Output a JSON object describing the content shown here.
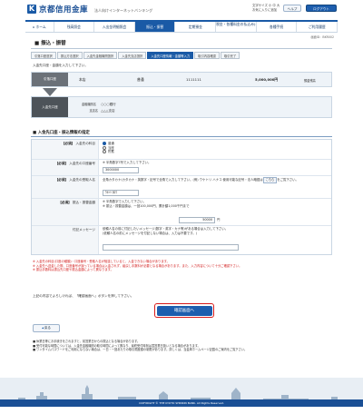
{
  "header": {
    "logo_mark": "K",
    "logo_text": "京都信用金庫",
    "logo_sub": "法人向けインターネットバンキング",
    "links": "文字サイズ 小 中 大\nお気に入りに追加",
    "help_label": "ヘルプ",
    "logout_label": "ログアウト"
  },
  "nav": {
    "items": [
      {
        "label": "ホーム"
      },
      {
        "label": "残高照会"
      },
      {
        "label": "入出金明細照会"
      },
      {
        "label": "振込・振替"
      },
      {
        "label": "定期預金"
      },
      {
        "label": "税金・各種料金の払込み(ペイジー)"
      },
      {
        "label": "各種手続"
      },
      {
        "label": "ご利用履歴"
      }
    ]
  },
  "screen_id": "画面ID：BKR002",
  "page_title": "振込・振替",
  "steps": [
    "引落口座選択",
    "振込方法選択",
    "入金先金融機関選択",
    "入金先支店選択",
    "入金先口座情報・金額等入力",
    "取引内容確認",
    "取引完了"
  ],
  "instruction": "入金先口座・金額を入力して下さい。",
  "from": {
    "head": "引落口座",
    "branch": "本店",
    "type": "普通",
    "number": "1111111",
    "balance": "5,000,000円",
    "balance_note": "預金残高"
  },
  "to": {
    "head": "入金先口座",
    "bank_label": "金融機関名",
    "bank_value": "○○○銀行",
    "branch_label": "支店名",
    "branch_value": "△△△支店"
  },
  "form": {
    "section_title": "入金先口座・振込情報の指定",
    "type": {
      "label": "入金先の科目",
      "options": [
        "普通",
        "当座",
        "貯蓄"
      ]
    },
    "account": {
      "label": "入金先の口座番号",
      "hint": "半角数字7桁で入力して下さい。",
      "value": "3000000"
    },
    "name": {
      "label": "入金先の受取人名",
      "hint": "全角カタカナ(カタカナ・英数字・記号で全角で入力して下さい。(例) ウケトリ ハナコ 使用可能な記号・法人略語は",
      "link": "こちら",
      "hint2": "をご覧下さい。",
      "value": "ｳｹﾄﾘ ﾀﾛｳ"
    },
    "amount": {
      "label": "振込・振替金額",
      "hint": "半角数字で入力して下さい。",
      "hint2": "振込・振替金額は、一回100,000円、累計額1,000千円まで",
      "value": "50000",
      "unit": "円"
    },
    "message": {
      "label": "付記メッセージ",
      "hint": "依頼人名の前に付記したいメッセージ(数字・英字・カナ等)がある場合は入力して下さい。",
      "hint2": "(依頼人名の前にメッセージを付記しない場合は、入力は不要です。)",
      "value": ""
    },
    "required_mark": "【必須】"
  },
  "notes": [
    "※ 入金先の科目(口座の種類)・口座番号・受取人名が相違していると、入金できない場合があります。",
    "※ 入金先へ送金した際、口座番号が誤っている場合は入金されず、組戻し手数料が必要となる場合があります。また、入力内容について十分ご確認下さい。",
    "※ 振込手数料は振込先口座や振込金額によって異なります。"
  ],
  "confirm_text": "上記の内容でよろしければ、「確認画面へ」ボタンを押して下さい。",
  "confirm_label": "確認画面へ",
  "back_label": "戻る",
  "bottom_notes": [
    "■ 休業日等にお手続きをされますと、前営業日からの振込となる場合があります。",
    "■ 受付可能な時間については、入金先金融機関の取引時間によって異なり、最終受付時刻は翌営業日扱いとなる場合があります。",
    "■ ワンタイムパスワードをご利用にならない場合は、一日・一回あたりの取引限度額の制限があります。詳しくは、当金庫ホームページ記載のご案内をご覧下さい。"
  ],
  "footer_copyright": "COPYRIGHT © THE KYOTO SHINKIN BANK. All Rights Reserved."
}
